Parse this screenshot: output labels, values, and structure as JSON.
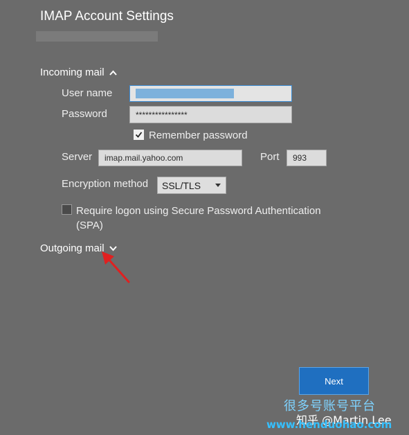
{
  "header": {
    "title": "IMAP Account Settings"
  },
  "incoming": {
    "section_label": "Incoming mail",
    "username_label": "User name",
    "password_label": "Password",
    "password_value": "****************",
    "remember_label": "Remember password",
    "remember_checked": true,
    "server_label": "Server",
    "server_value": "imap.mail.yahoo.com",
    "port_label": "Port",
    "port_value": "993",
    "encryption_label": "Encryption method",
    "encryption_value": "SSL/TLS",
    "spa_label_line1": "Require logon using Secure Password Authentication",
    "spa_label_line2": "(SPA)",
    "spa_checked": false
  },
  "outgoing": {
    "section_label": "Outgoing mail"
  },
  "footer": {
    "next_label": "Next"
  },
  "watermark": {
    "line1": "很多号账号平台",
    "line2": "知乎 @Martin Lee",
    "line3": "www.henduohao.com"
  },
  "colors": {
    "background": "#6b6b6b",
    "accent_button": "#1f6fc0",
    "focus_border": "#3d8fd8",
    "annotation_arrow": "#e02020"
  },
  "icons": {
    "incoming_chevron": "chevron-up-icon",
    "outgoing_chevron": "chevron-down-icon",
    "dropdown": "caret-down-icon",
    "annotation": "arrow-icon"
  }
}
